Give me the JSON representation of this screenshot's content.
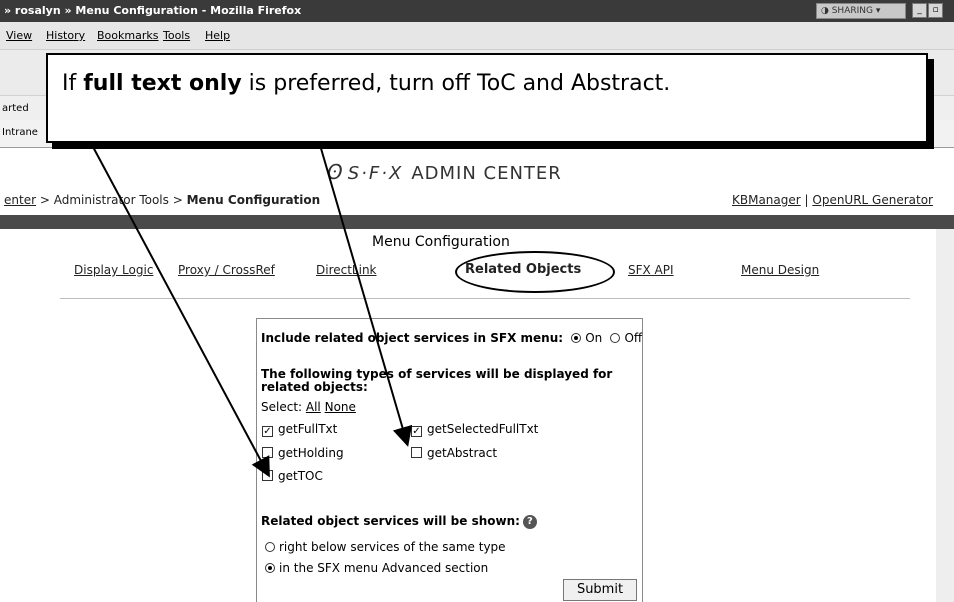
{
  "window": {
    "title": "» rosalyn » Menu Configuration - Mozilla Firefox",
    "sharing_label": "SHARING",
    "min_glyph": "_",
    "max_glyph": "▫"
  },
  "menubar": [
    "View",
    "History",
    "Bookmarks",
    "Tools",
    "Help"
  ],
  "bookmarks": {
    "started": "arted",
    "intranet": "Intrane"
  },
  "callout": {
    "prefix": "If ",
    "emphasis": "full text only",
    "suffix": " is preferred, turn off ToC and Abstract."
  },
  "header": {
    "logo_mark": "S·F·X",
    "logo_text": "ADMIN CENTER",
    "breadcrumb_link": "enter",
    "breadcrumb_mid": " > Administrator Tools > ",
    "breadcrumb_current": "Menu Configuration",
    "links": [
      "KBManager",
      "OpenURL Generator"
    ]
  },
  "page": {
    "title": "Menu Configuration",
    "tabs": [
      "Display Logic",
      "Proxy / CrossRef",
      "DirectLink",
      "Related Objects",
      "SFX API",
      "Menu Design"
    ]
  },
  "form": {
    "include_label": "Include related object services in SFX menu:",
    "on_label": "On",
    "off_label": "Off",
    "include_value": "On",
    "types_heading_1": "The following types of services will be displayed for",
    "types_heading_2": "related objects:",
    "select_label": "Select:",
    "select_all": "All",
    "select_none": "None",
    "services": [
      {
        "label": "getFullTxt",
        "checked": true
      },
      {
        "label": "getSelectedFullTxt",
        "checked": true
      },
      {
        "label": "getHolding",
        "checked": false
      },
      {
        "label": "getAbstract",
        "checked": false
      },
      {
        "label": "getTOC",
        "checked": false
      }
    ],
    "shown_label": "Related object services will be shown:",
    "shown_options": [
      "right below services of the same type",
      "in the SFX menu Advanced section"
    ],
    "shown_value": "in the SFX menu Advanced section",
    "submit_label": "Submit"
  }
}
